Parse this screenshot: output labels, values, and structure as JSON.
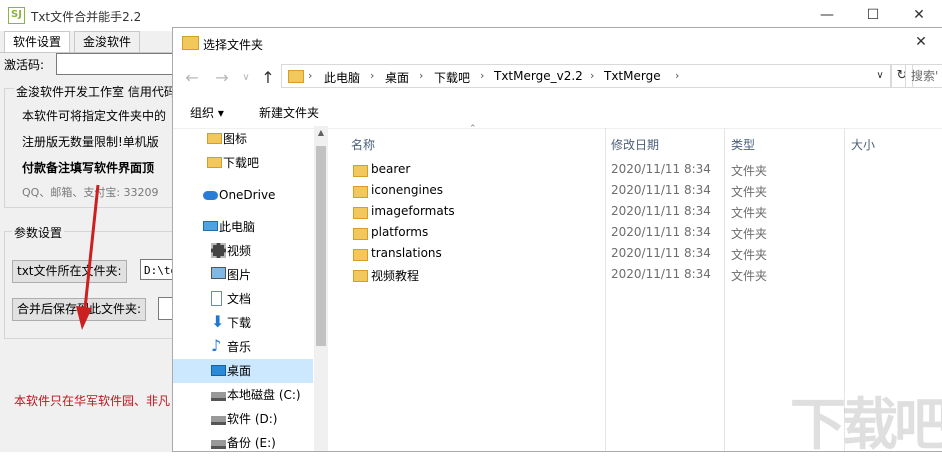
{
  "app": {
    "title": "Txt文件合并能手2.2",
    "tabs": [
      "软件设置",
      "金浚软件"
    ],
    "reg_label": "激活码:",
    "info_group_title": "金浚软件开发工作室  信用代码",
    "info_lines": [
      "本软件可将指定文件夹中的",
      "注册版无数量限制!单机版",
      "付款备注填写软件界面顶",
      "QQ、邮箱、支付宝: 33209"
    ],
    "params_group_title": "参数设置",
    "src_folder_button": "txt文件所在文件夹:",
    "src_folder_value": "D:\\to",
    "dst_folder_button": "合并后保存到此文件夹:",
    "footer_note": "本软件只在华军软件园、非凡"
  },
  "dialog": {
    "title": "选择文件夹",
    "breadcrumbs": [
      "此电脑",
      "桌面",
      "下载吧",
      "TxtMerge_v2.2",
      "TxtMerge"
    ],
    "search_placeholder": "搜索'",
    "organize_label": "组织 ▾",
    "new_folder_label": "新建文件夹",
    "nav_items": [
      {
        "label": "图标",
        "icon": "folder-icon"
      },
      {
        "label": "下载吧",
        "icon": "folder-icon"
      },
      {
        "label": "OneDrive",
        "icon": "cloud-icon"
      },
      {
        "label": "此电脑",
        "icon": "computer-icon"
      },
      {
        "label": "视频",
        "icon": "video-icon"
      },
      {
        "label": "图片",
        "icon": "picture-icon"
      },
      {
        "label": "文档",
        "icon": "document-icon"
      },
      {
        "label": "下载",
        "icon": "download-icon"
      },
      {
        "label": "音乐",
        "icon": "music-icon"
      },
      {
        "label": "桌面",
        "icon": "desktop-icon"
      },
      {
        "label": "本地磁盘 (C:)",
        "icon": "drive-icon"
      },
      {
        "label": "软件 (D:)",
        "icon": "drive-icon"
      },
      {
        "label": "备份 (E:)",
        "icon": "drive-icon"
      }
    ],
    "columns": [
      "名称",
      "修改日期",
      "类型",
      "大小"
    ],
    "files": [
      {
        "name": "bearer",
        "date": "2020/11/11 8:34",
        "type": "文件夹"
      },
      {
        "name": "iconengines",
        "date": "2020/11/11 8:34",
        "type": "文件夹"
      },
      {
        "name": "imageformats",
        "date": "2020/11/11 8:34",
        "type": "文件夹"
      },
      {
        "name": "platforms",
        "date": "2020/11/11 8:34",
        "type": "文件夹"
      },
      {
        "name": "translations",
        "date": "2020/11/11 8:34",
        "type": "文件夹"
      },
      {
        "name": "视频教程",
        "date": "2020/11/11 8:34",
        "type": "文件夹"
      }
    ]
  },
  "watermark": "下载吧",
  "colors": {
    "folder": "#f2c75c",
    "selected": "#cce8ff",
    "footer_red": "#c0141e",
    "arrow": "#cc1f1f"
  }
}
